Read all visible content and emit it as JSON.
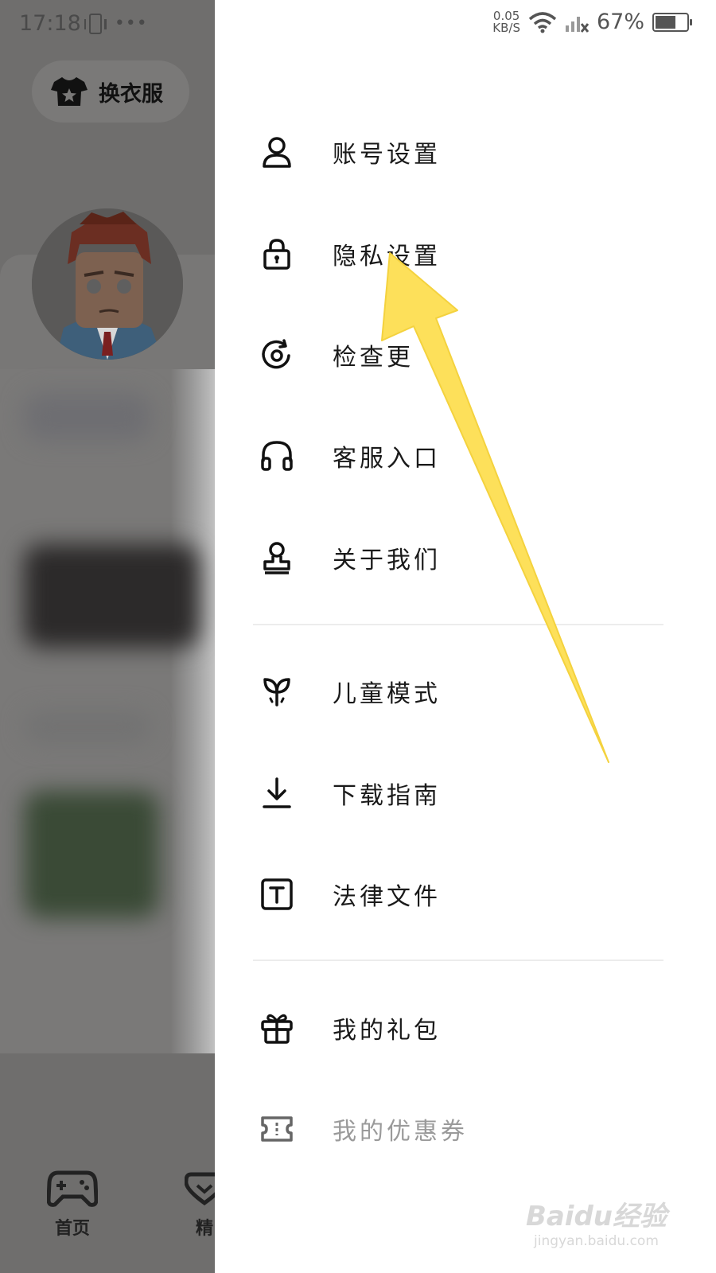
{
  "background_app": {
    "status_time": "17:18",
    "status_dots": "•••",
    "outfit_button_label": "换衣服",
    "nav_home_label": "首页",
    "nav_featured_label": "精"
  },
  "status_bar": {
    "net_speed_value": "0.05",
    "net_speed_unit": "KB/S",
    "battery_percent": "67%",
    "battery_level": 0.67
  },
  "drawer": {
    "group1": [
      {
        "label": "账号设置",
        "icon": "user-icon"
      },
      {
        "label": "隐私设置",
        "icon": "lock-icon"
      },
      {
        "label": "检查更",
        "icon": "refresh-icon"
      },
      {
        "label": "客服入口",
        "icon": "headset-icon"
      },
      {
        "label": "关于我们",
        "icon": "stamp-icon"
      }
    ],
    "group2": [
      {
        "label": "儿童模式",
        "icon": "sprout-icon"
      },
      {
        "label": "下载指南",
        "icon": "download-icon"
      },
      {
        "label": "法律文件",
        "icon": "text-doc-icon"
      }
    ],
    "group3": [
      {
        "label": "我的礼包",
        "icon": "gift-icon"
      },
      {
        "label": "我的优惠券",
        "icon": "coupon-icon"
      }
    ]
  },
  "watermark": {
    "main": "Baidu经验",
    "sub": "jingyan.baidu.com"
  },
  "colors": {
    "overlay": "#6f6e6d",
    "arrow": "#fde05a",
    "text": "#1a1a1a"
  }
}
